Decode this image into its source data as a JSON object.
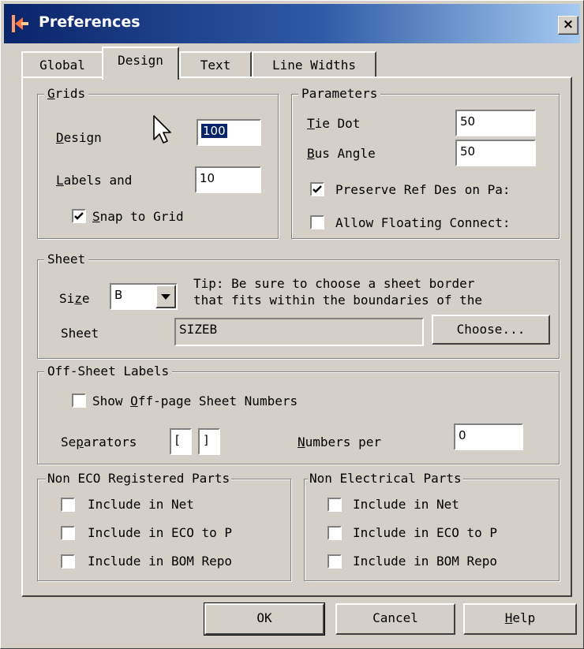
{
  "window": {
    "title": "Preferences",
    "close_glyph": "×"
  },
  "tabs": [
    {
      "label": "Global"
    },
    {
      "label": "Design"
    },
    {
      "label": "Text"
    },
    {
      "label": "Line Widths"
    }
  ],
  "grids": {
    "legend_mn": "G",
    "legend_rest": "rids",
    "design_mn": "D",
    "design_rest": "esign",
    "design_value": "100",
    "labels_mn": "L",
    "labels_rest": "abels and",
    "labels_value": "10",
    "snap_mn": "S",
    "snap_rest": "nap to Grid",
    "snap_checked": true
  },
  "parameters": {
    "legend": "Parameters",
    "tie_mn": "T",
    "tie_rest": "ie Dot",
    "tie_value": "50",
    "bus_mn": "B",
    "bus_rest": "us Angle",
    "bus_value": "50",
    "preserve_label": "Preserve Ref Des on Pa:",
    "preserve_checked": true,
    "floating_label": "Allow Floating Connect:",
    "floating_checked": false
  },
  "sheet": {
    "legend": "Sheet",
    "size_a": "Si",
    "size_mn": "z",
    "size_b": "e",
    "size_value": "B",
    "tip_line1": "Tip: Be sure to choose a sheet border",
    "tip_line2": "that fits within the boundaries of the",
    "sheet_label": "Sheet",
    "sheet_value": "SIZEB",
    "choose_label": "Choose..."
  },
  "off_sheet": {
    "legend": "Off-Sheet Labels",
    "show_a": "Show ",
    "show_mn": "O",
    "show_b": "ff-page Sheet Numbers",
    "show_checked": false,
    "sep_a": "Se",
    "sep_mn": "p",
    "sep_b": "arators",
    "sep_open": "[",
    "sep_close": "]",
    "num_mn": "N",
    "num_rest": "umbers per",
    "num_value": "0"
  },
  "non_eco": {
    "legend": "Non ECO Registered Parts",
    "items": [
      "Include in Net",
      "Include in ECO to P",
      "Include in BOM Repo"
    ]
  },
  "non_elec": {
    "legend": "Non Electrical Parts",
    "items": [
      "Include in Net",
      "Include in ECO to P",
      "Include in BOM Repo"
    ]
  },
  "buttons": {
    "ok": "OK",
    "cancel": "Cancel",
    "help_mn": "H",
    "help_rest": "elp"
  },
  "icons": [
    "app-icon",
    "close-icon",
    "checkmark-icon",
    "dropdown-arrow-icon",
    "mouse-cursor-icon"
  ]
}
